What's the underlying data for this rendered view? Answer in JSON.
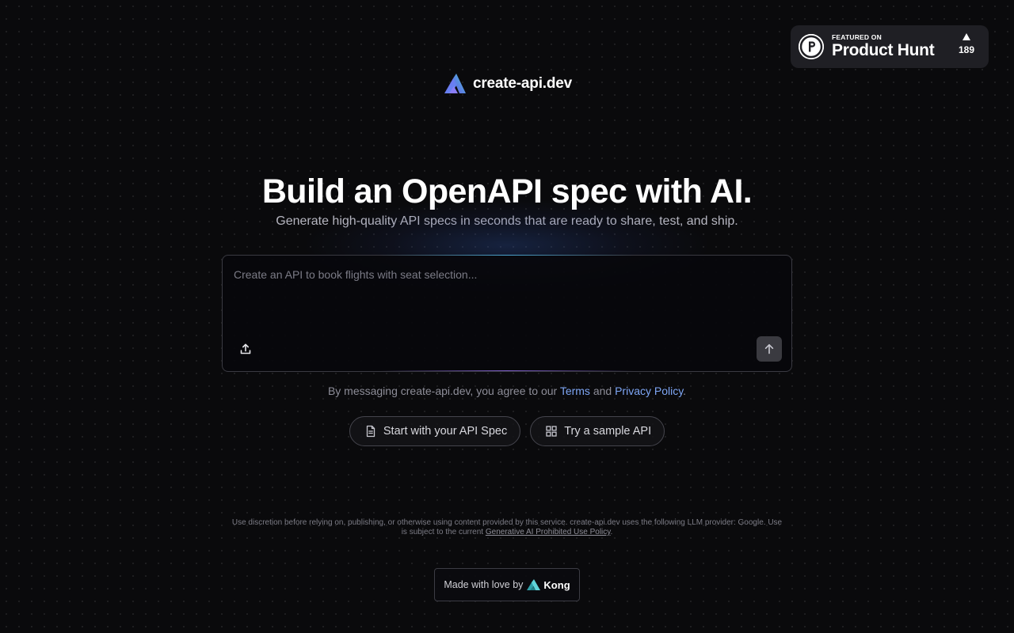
{
  "product_hunt": {
    "featured_label": "FEATURED ON",
    "name": "Product Hunt",
    "votes": "189",
    "logo_letter": "P"
  },
  "brand": {
    "name": "create-api.dev",
    "logo_icon": "create-api-logo-icon"
  },
  "hero": {
    "title": "Build an OpenAPI spec with AI.",
    "subtitle": "Generate high-quality API specs in seconds that are ready to share, test, and ship."
  },
  "prompt": {
    "placeholder": "Create an API to book flights with seat selection...",
    "value": "",
    "upload_icon": "upload-icon",
    "send_icon": "arrow-up-icon"
  },
  "consent": {
    "prefix": "By messaging create-api.dev, you agree to our ",
    "terms": "Terms",
    "and": " and ",
    "privacy": "Privacy Policy",
    "suffix": "."
  },
  "actions": {
    "start_spec": "Start with your API Spec",
    "try_sample": "Try a sample API"
  },
  "disclaimer": {
    "text": "Use discretion before relying on, publishing, or otherwise using content provided by this service. create-api.dev uses the following LLM provider: Google. Use is subject to the current ",
    "link": "Generative AI Prohibited Use Policy",
    "suffix": "."
  },
  "footer": {
    "made_by": "Made with love by",
    "company": "Kong"
  },
  "colors": {
    "background": "#0a0a0c",
    "link": "#7ea6f5",
    "brand_gradient_start": "#6a5cf0",
    "brand_gradient_end": "#4fd1e8"
  }
}
